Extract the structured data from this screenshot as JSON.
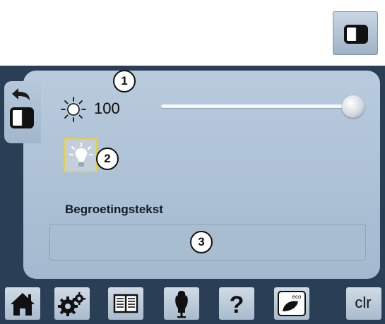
{
  "display_settings": {
    "brightness": {
      "icon": "sun-icon",
      "value": "100",
      "slider_level": 1.0
    },
    "light_toggle": {
      "icon": "lightbulb-icon"
    },
    "greeting_label": "Begroetingstekst",
    "greeting_text": ""
  },
  "callouts": [
    "1",
    "2",
    "3"
  ],
  "toolbar": {
    "home": "home-icon",
    "setup": "gears-icon",
    "tutorial": "book-icon",
    "creative_consultant": "dress-form-icon",
    "help": "question-mark-icon",
    "eco": "eco-icon",
    "clear_label": "clr"
  },
  "colors": {
    "screen_background": "#2a3e55",
    "panel": "#b0c3d6",
    "highlight_border": "#e6d23a"
  }
}
